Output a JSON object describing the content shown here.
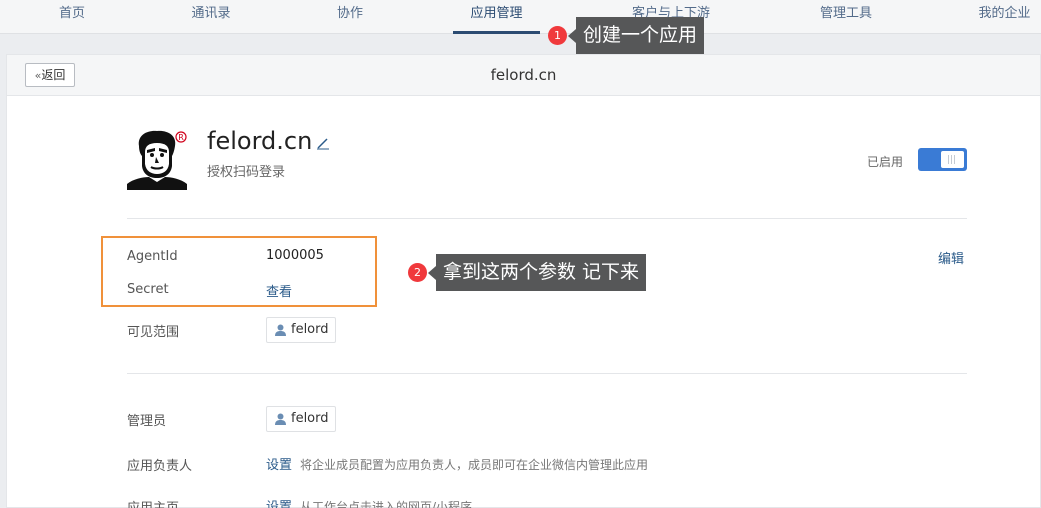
{
  "nav": {
    "tabs": [
      {
        "label": "首页"
      },
      {
        "label": "通讯录"
      },
      {
        "label": "协作"
      },
      {
        "label": "应用管理"
      },
      {
        "label": "客户与上下游"
      },
      {
        "label": "管理工具"
      },
      {
        "label": "我的企业"
      }
    ],
    "active_tab": "应用管理"
  },
  "card": {
    "back_label": "返回",
    "title": "felord.cn"
  },
  "app": {
    "name": "felord.cn",
    "description": "授权扫码登录",
    "status_label": "已启用",
    "enabled": true,
    "edit_label": "编辑"
  },
  "details": {
    "agentid_label": "AgentId",
    "agentid_value": "1000005",
    "secret_label": "Secret",
    "secret_value": "查看",
    "visible_label": "可见范围",
    "visible_user": "felord",
    "admin_label": "管理员",
    "admin_user": "felord",
    "owner_label": "应用负责人",
    "owner_link": "设置",
    "owner_hint": "将企业成员配置为应用负责人，成员即可在企业微信内管理此应用",
    "homepage_label": "应用主页",
    "homepage_link": "设置",
    "homepage_hint": "从工作台点击进入的网页/小程序"
  },
  "annotations": {
    "step1_number": "1",
    "step1_text": "创建一个应用",
    "step2_number": "2",
    "step2_text": "拿到这两个参数 记下来"
  },
  "colors": {
    "accent": "#2b4b72",
    "toggle": "#3a7bd5",
    "highlight_box": "#f0913a",
    "badge": "#f0393c",
    "callout": "#565758"
  }
}
